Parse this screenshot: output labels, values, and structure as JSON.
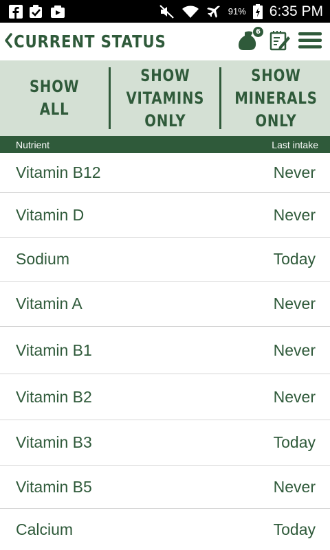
{
  "status_bar": {
    "left_icons": [
      "facebook-icon",
      "checkbox-icon",
      "video-icon"
    ],
    "right_icons": [
      "mute-icon",
      "wifi-icon",
      "airplane-icon"
    ],
    "battery": "91%",
    "time": "6:35 PM"
  },
  "header": {
    "title": "CURRENT STATUS",
    "badge": "6",
    "icons": [
      "back-chevron-icon",
      "supplement-bag-icon",
      "notes-edit-icon",
      "hamburger-menu-icon"
    ]
  },
  "filters": [
    {
      "label": "SHOW\nALL"
    },
    {
      "label": "SHOW\nVITAMINS\nONLY"
    },
    {
      "label": "SHOW\nMINERALS\nONLY"
    }
  ],
  "columns": {
    "nutrient": "Nutrient",
    "last_intake": "Last intake"
  },
  "rows": [
    {
      "name": "Vitamin B12",
      "value": "Never"
    },
    {
      "name": "Vitamin D",
      "value": "Never"
    },
    {
      "name": "Sodium",
      "value": "Today"
    },
    {
      "name": "Vitamin A",
      "value": "Never"
    },
    {
      "name": "Vitamin B1",
      "value": "Never"
    },
    {
      "name": "Vitamin B2",
      "value": "Never"
    },
    {
      "name": "Vitamin B3",
      "value": "Today"
    },
    {
      "name": "Vitamin B5",
      "value": "Never"
    },
    {
      "name": "Calcium",
      "value": "Today"
    }
  ],
  "colors": {
    "accent": "#2f5a3a",
    "filter_bg": "#d4e0d4"
  }
}
